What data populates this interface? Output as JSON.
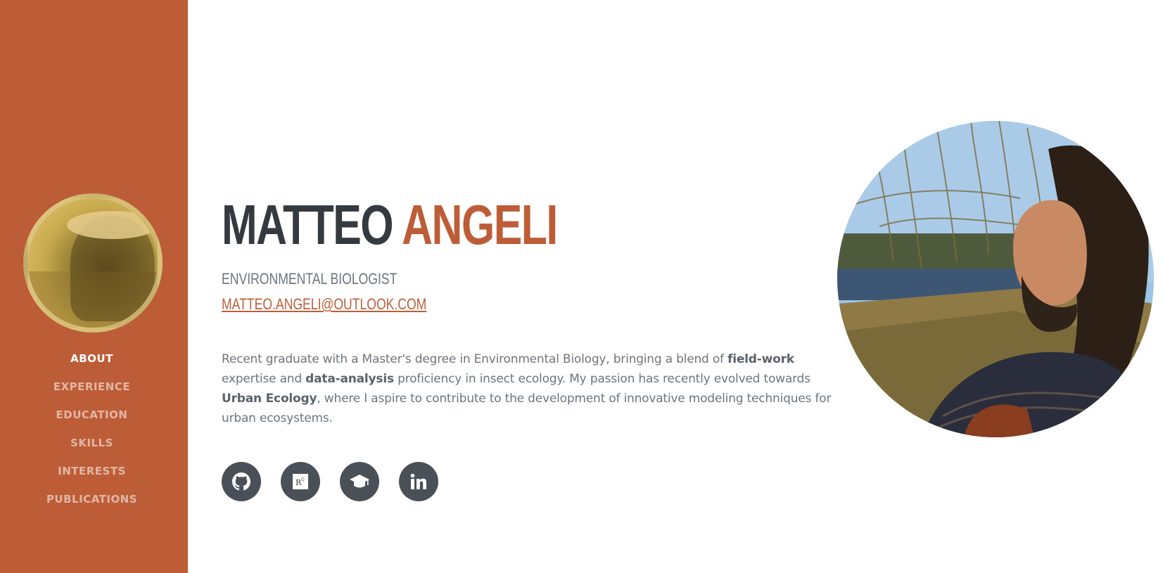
{
  "colors": {
    "primary": "#bd5d38",
    "dark": "#343a40",
    "muted": "#6c757d",
    "icon_bg": "#495057"
  },
  "sidebar": {
    "nav": [
      {
        "label": "ABOUT",
        "active": true
      },
      {
        "label": "EXPERIENCE",
        "active": false
      },
      {
        "label": "EDUCATION",
        "active": false
      },
      {
        "label": "SKILLS",
        "active": false
      },
      {
        "label": "INTERESTS",
        "active": false
      },
      {
        "label": "PUBLICATIONS",
        "active": false
      }
    ]
  },
  "about": {
    "first_name": "MATTEO",
    "last_name": "ANGELI",
    "title": "ENVIRONMENTAL BIOLOGIST",
    "email": "MATTEO.ANGELI@OUTLOOK.COM",
    "bio": [
      "Recent graduate with a Master's degree in Environmental Biology, bringing a blend of ",
      "field-work",
      " expertise and ",
      "data-analysis",
      " proficiency in insect ecology. My passion has recently evolved towards ",
      "Urban Ecology",
      ", where I aspire to contribute to the development of innovative modeling techniques for urban ecosystems."
    ]
  },
  "social": [
    {
      "icon": "github-icon"
    },
    {
      "icon": "researchgate-icon",
      "glyph": "Rᴳ"
    },
    {
      "icon": "graduation-cap-icon"
    },
    {
      "icon": "linkedin-icon",
      "glyph": "in"
    }
  ]
}
